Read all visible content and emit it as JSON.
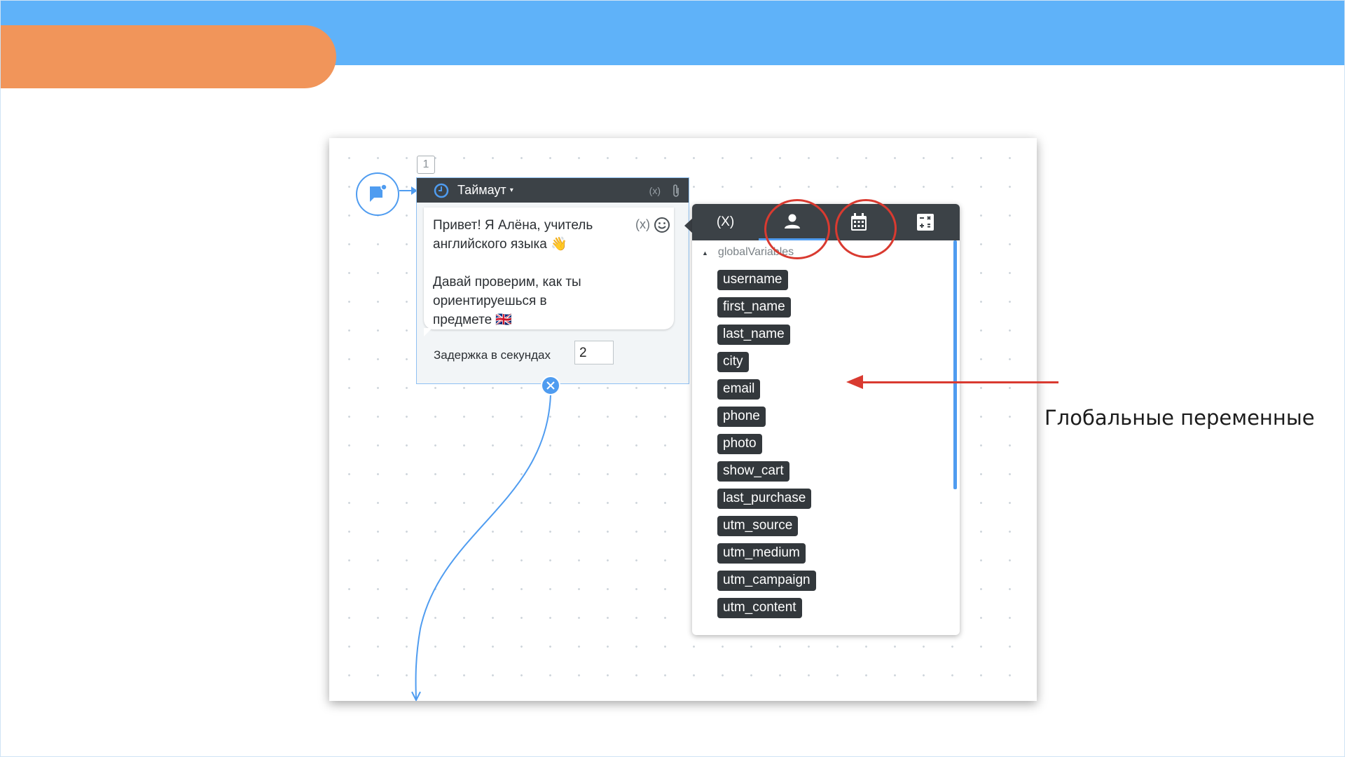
{
  "slide": {
    "callout_label": "Глобальные переменные",
    "colors": {
      "top_band": "#5fb2f9",
      "accent_pill": "#f1955a",
      "annotation": "#d93a30"
    }
  },
  "canvas": {
    "node_number": "1",
    "start_icon": "chat-flag-icon",
    "node": {
      "title": "Таймаут",
      "header_var_label": "(x)",
      "attach_icon": "paperclip-icon",
      "message_text": "Привет! Я Алёна, учитель\nанглийского языка 👋\n\nДавай проверим, как ты\nориентируешься в\nпредмете 🇬🇧",
      "message_var_label": "(x)",
      "delay_label": "Задержка в секундах",
      "delay_value": "2"
    }
  },
  "variables_popup": {
    "tabs": [
      {
        "label": "(X)",
        "icon": "variable-icon"
      },
      {
        "label": "",
        "icon": "user-icon",
        "active": true
      },
      {
        "label": "",
        "icon": "calendar-icon"
      },
      {
        "label": "",
        "icon": "calculator-icon"
      }
    ],
    "group_label": "globalVariables",
    "variables": [
      "username",
      "first_name",
      "last_name",
      "city",
      "email",
      "phone",
      "photo",
      "show_cart",
      "last_purchase",
      "utm_source",
      "utm_medium",
      "utm_campaign",
      "utm_content"
    ]
  }
}
